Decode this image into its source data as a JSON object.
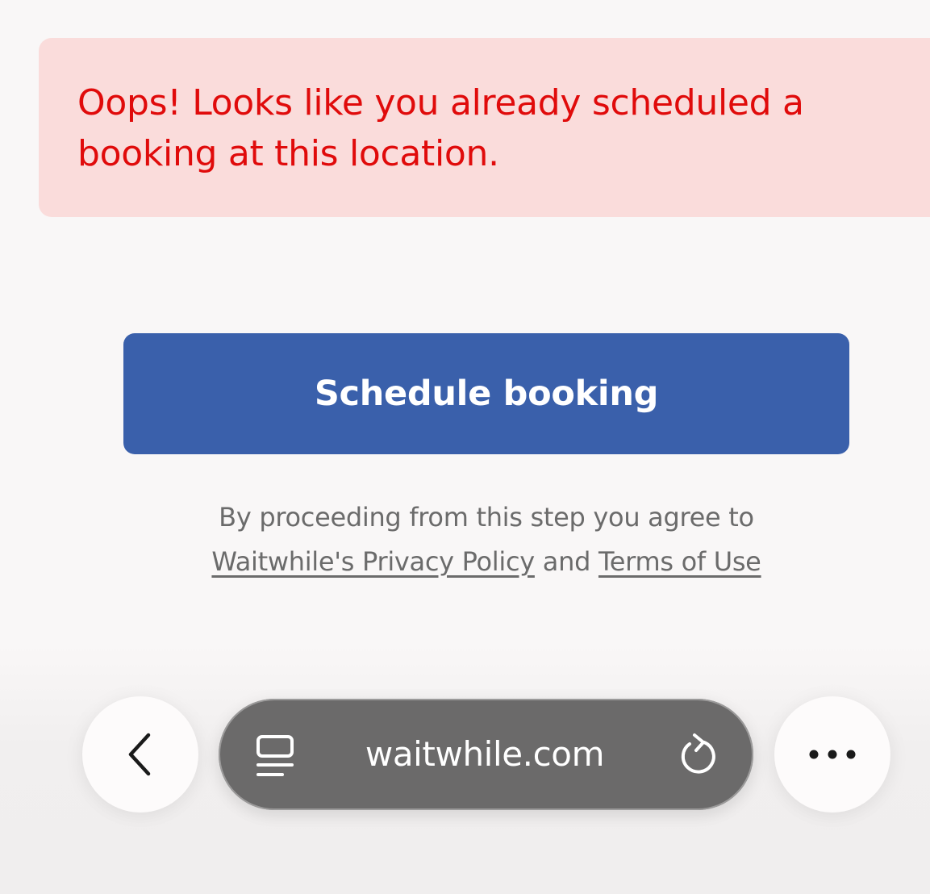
{
  "error": {
    "message": "Oops! Looks like you already scheduled a booking at this location."
  },
  "cta": {
    "label": "Schedule booking"
  },
  "legal": {
    "prefix": "By proceeding from this step you agree to",
    "privacy_link": "Waitwhile's Privacy Policy",
    "conjunction": "and",
    "terms_link": "Terms of Use"
  },
  "browser": {
    "url": "waitwhile.com",
    "icons": {
      "back": "chevron-left-icon",
      "reader": "reader-mode-icon",
      "reload": "reload-icon",
      "more": "more-options-icon"
    }
  },
  "colors": {
    "error_text": "#e00b0b",
    "error_background": "#fadcdb",
    "primary_button": "#3a60ab",
    "url_bar": "#6b6a6a",
    "page_background": "#f9f7f7"
  }
}
